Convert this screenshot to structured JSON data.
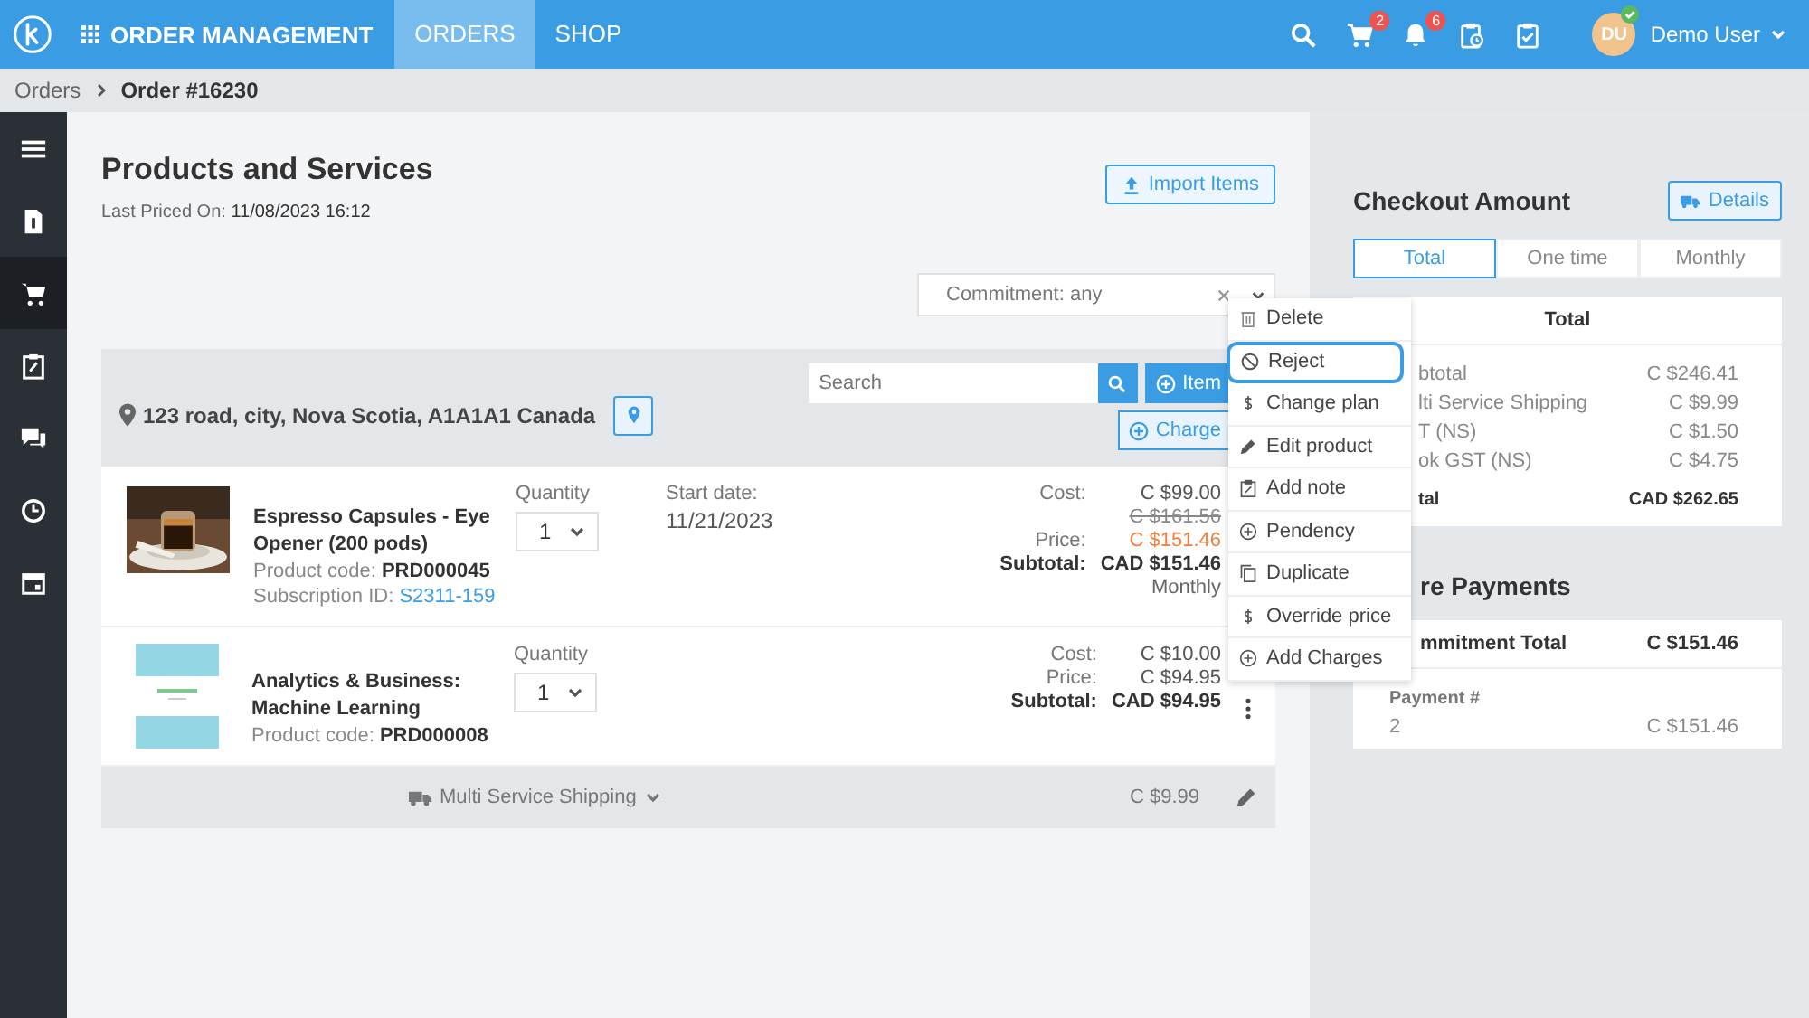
{
  "topbar": {
    "app_title": "ORDER MANAGEMENT",
    "nav": [
      {
        "label": "ORDERS",
        "selected": true
      },
      {
        "label": "SHOP",
        "selected": false
      }
    ],
    "cart_badge": "2",
    "bell_badge": "6",
    "user_initials": "DU",
    "user_name": "Demo User"
  },
  "breadcrumb": [
    "Orders",
    "Order #16230"
  ],
  "sidebar": [
    {
      "kind": "menu",
      "selected": false
    },
    {
      "kind": "invoice",
      "selected": false
    },
    {
      "kind": "cart",
      "selected": true
    },
    {
      "kind": "clipboard",
      "selected": false
    },
    {
      "kind": "chat",
      "selected": false
    },
    {
      "kind": "clock",
      "selected": false
    },
    {
      "kind": "calendar",
      "selected": false
    }
  ],
  "page": {
    "title": "Products and Services",
    "last_priced_label": "Last Priced On:",
    "last_priced_value": "11/08/2023 16:12",
    "import_button": "Import Items"
  },
  "filter": {
    "value": "Commitment: any"
  },
  "location": {
    "address": "123 road, city, Nova Scotia, A1A1A1 Canada",
    "search_placeholder": "Search",
    "item_button": "Item",
    "charge_button": "Charge"
  },
  "products": [
    {
      "name": "Espresso Capsules - Eye Opener (200 pods)",
      "code_label": "Product code:",
      "code": "PRD000045",
      "subscription_label": "Subscription ID:",
      "subscription": "S2311-159",
      "quantity_label": "Quantity",
      "quantity": "1",
      "start_label": "Start date:",
      "start_date": "11/21/2023",
      "prices": [
        {
          "label": "Cost:",
          "value": "C $99.00",
          "kind": "plain"
        },
        {
          "value": "C $161.56",
          "kind": "strike"
        },
        {
          "label": "Price:",
          "value": "C $151.46",
          "kind": "accent"
        },
        {
          "label": "Subtotal:",
          "value": "CAD $151.46",
          "kind": "total"
        },
        {
          "value": "Monthly",
          "kind": "note"
        }
      ],
      "kebab": false
    },
    {
      "name": "Analytics & Business: Machine Learning",
      "code_label": "Product code:",
      "code": "PRD000008",
      "quantity_label": "Quantity",
      "quantity": "1",
      "prices": [
        {
          "label": "Cost:",
          "value": "C $10.00",
          "kind": "plain"
        },
        {
          "label": "Price:",
          "value": "C $94.95",
          "kind": "plain"
        },
        {
          "label": "Subtotal:",
          "value": "CAD $94.95",
          "kind": "total"
        }
      ],
      "kebab": true
    }
  ],
  "shipping": {
    "label": "Multi Service Shipping",
    "price": "C $9.99"
  },
  "menu": [
    {
      "label": "Delete",
      "kind": "trash",
      "selected": false
    },
    {
      "label": "Reject",
      "kind": "ban",
      "selected": true
    },
    {
      "label": "Change plan",
      "kind": "dollar",
      "selected": false
    },
    {
      "label": "Edit product",
      "kind": "pencil",
      "selected": false
    },
    {
      "label": "Add note",
      "kind": "note",
      "selected": false
    },
    {
      "label": "Pendency",
      "kind": "plus",
      "selected": false
    },
    {
      "label": "Duplicate",
      "kind": "copy",
      "selected": false
    },
    {
      "label": "Override price",
      "kind": "dollar",
      "selected": false
    },
    {
      "label": "Add Charges",
      "kind": "plus",
      "selected": false
    }
  ],
  "checkout": {
    "title": "Checkout Amount",
    "details_button": "Details",
    "tabs": [
      {
        "label": "Total",
        "selected": true
      },
      {
        "label": "One time",
        "selected": false
      },
      {
        "label": "Monthly",
        "selected": false
      }
    ],
    "table_title": "Total",
    "rows": [
      {
        "label": "btotal",
        "value": "C $246.41"
      },
      {
        "label": "lti Service Shipping",
        "value": "C $9.99"
      },
      {
        "label": "T (NS)",
        "value": "C $1.50"
      },
      {
        "label": "ok GST (NS)",
        "value": "C $4.75"
      }
    ],
    "total_label": "tal",
    "total_value": "CAD $262.65"
  },
  "payments": {
    "title": "re Payments",
    "header_label": "mmitment Total",
    "header_value": "C $151.46",
    "column_label": "Payment #",
    "rows": [
      {
        "number": "2",
        "amount": "C $151.46"
      }
    ]
  }
}
